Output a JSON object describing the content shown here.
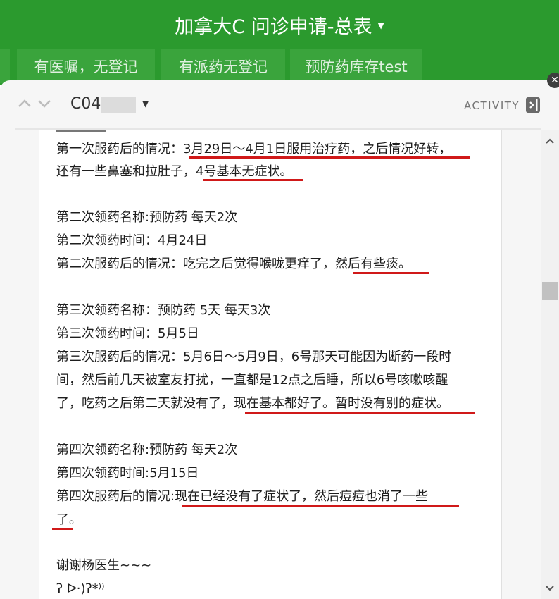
{
  "header": {
    "title": "加拿大C 问诊申请-总表",
    "tabs": [
      "有医嘱，无登记",
      "有派药无登记",
      "预防药库存test"
    ]
  },
  "record": {
    "id": "C04",
    "activity_label": "ACTIVITY"
  },
  "content": {
    "lines": [
      "第一次服药后的情况：3月29日～4月1日服用治疗药，之后情况好转，",
      "还有一些鼻塞和拉肚子，4号基本无症状。",
      "第二次领药名称:预防药 每天2次",
      "第二次领药时间：4月24日",
      "第二次服药后的情况：吃完之后觉得喉咙更痒了，然后有些痰。",
      "第三次领药名称：预防药 5天 每天3次",
      "第三次领药时间：5月5日",
      "第三次服药后的情况：5月6日～5月9日，6号那天可能因为断药一段时",
      "间，然后前几天被室友打扰，一直都是12点之后睡，所以6号咳嗽咳醒",
      "了，吃药之后第二天就没有了，现在基本都好了。暂时没有别的症状。",
      "第四次领药名称:预防药 每天2次",
      "第四次领药时间:5月15日",
      "第四次服药后的情况:现在已经没有了症状了，然后痘痘也消了一些",
      "了。",
      "谢谢杨医生~~~",
      "ʔ ᐅ·)ʔ*⁾⁾"
    ]
  },
  "colors": {
    "header_green": "#2b9a2e",
    "tab_green": "#3aa43c",
    "underline_red": "#d01919"
  },
  "icons": {
    "close": "close-icon",
    "nav_up": "chevron-up-icon",
    "nav_down": "chevron-down-icon",
    "activity": "activity-panel-icon"
  }
}
